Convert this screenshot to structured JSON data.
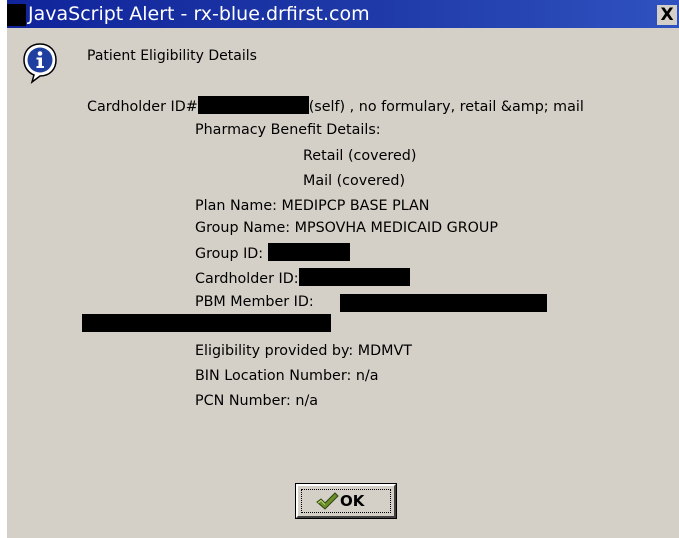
{
  "window": {
    "title": "JavaScript Alert - rx-blue.drfirst.com",
    "close_glyph": "X",
    "title_bar_color": "#1a2fa4",
    "background_color": "#d4d0c8"
  },
  "dialog": {
    "icon": "info-icon",
    "heading": "Patient Eligibility Details",
    "cardholder_line": {
      "prefix": "Cardholder ID#",
      "suffix": "(self) , no formulary, retail &amp; mail"
    },
    "pharmacy_benefit_label": "Pharmacy Benefit Details:",
    "benefits": [
      "Retail (covered)",
      "Mail (covered)"
    ],
    "plan_name": "Plan Name: MEDIPCP BASE PLAN",
    "group_name": "Group Name: MPSOVHA MEDICAID GROUP",
    "group_id_label": "Group ID:",
    "cardholder_id_label": "Cardholder ID:",
    "pbm_member_id_label": "PBM Member ID:",
    "eligibility_provided_by": "Eligibility provided by: MDMVT",
    "bin_location_number": "BIN Location Number: n/a",
    "pcn_number": "PCN Number: n/a"
  },
  "ok_button": {
    "label": "OK",
    "icon": "check-hand-icon"
  }
}
